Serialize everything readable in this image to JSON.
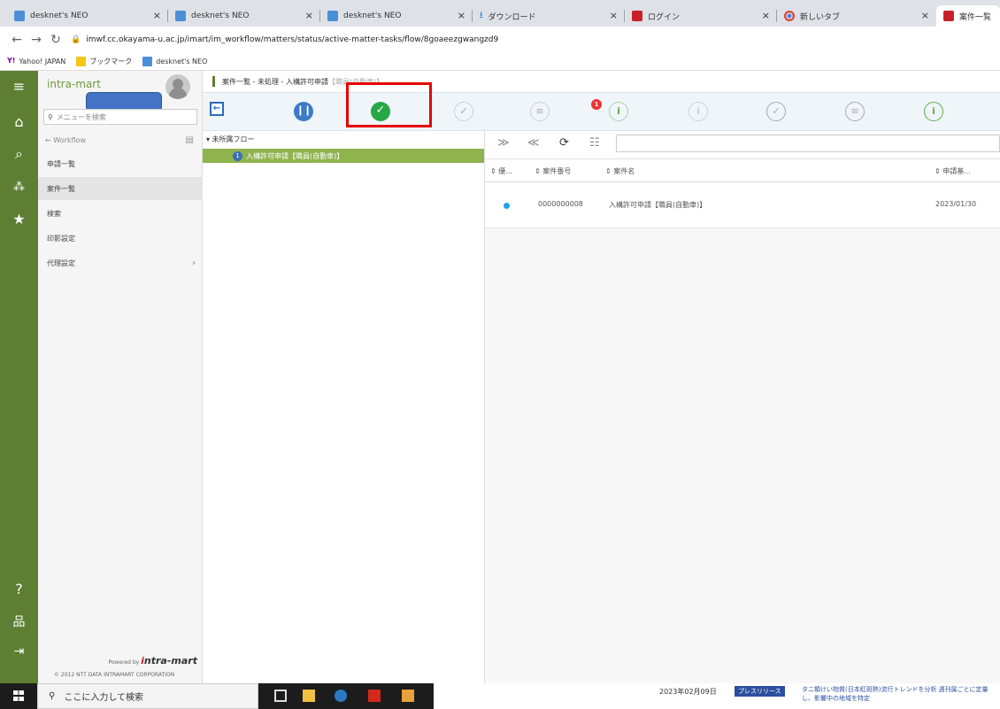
{
  "browser": {
    "tabs": [
      {
        "label": "desknet's NEO",
        "icon": "desknets-icon",
        "active": false
      },
      {
        "label": "desknet's NEO",
        "icon": "desknets-icon",
        "active": false
      },
      {
        "label": "desknet's NEO",
        "icon": "desknets-icon",
        "active": false
      },
      {
        "label": "ダウンロード",
        "icon": "download-icon",
        "active": false
      },
      {
        "label": "ログイン",
        "icon": "intramart-icon",
        "active": false
      },
      {
        "label": "新しいタブ",
        "icon": "chrome-icon",
        "active": false
      },
      {
        "label": "案件一覧",
        "icon": "intramart-icon",
        "active": true
      }
    ],
    "close_glyph": "×",
    "url": "imwf.cc.okayama-u.ac.jp/imart/im_workflow/matters/status/active-matter-tasks/flow/8goaeezgwangzd9",
    "bookmarks": [
      {
        "label": "Yahoo! JAPAN",
        "icon": "yahoo-icon"
      },
      {
        "label": "ブックマーク",
        "icon": "folder-icon"
      },
      {
        "label": "desknet's NEO",
        "icon": "desknets-icon"
      }
    ]
  },
  "sidebar": {
    "brand": "intra-mart",
    "search_placeholder": "メニューを検索",
    "back_label": "← Workflow",
    "items": [
      {
        "label": "申請一覧",
        "selected": false
      },
      {
        "label": "案件一覧",
        "selected": true
      },
      {
        "label": "検索",
        "selected": false
      },
      {
        "label": "印影設定",
        "selected": false
      },
      {
        "label": "代理設定",
        "selected": false,
        "has_children": true
      }
    ],
    "powered_by": "Powered by",
    "powered_brand_i": "i",
    "powered_brand_rest": "ntra-mart",
    "copyright": "© 2012 NTT DATA INTRAMART CORPORATION"
  },
  "breadcrumb": {
    "text": "案件一覧 - 未処理 - 入構許可申請",
    "tail": "【職員(自動車)】"
  },
  "status_toolbar": {
    "active_count": "1",
    "icons": [
      "collapse-panel-icon",
      "pause-icon",
      "approved-check-icon",
      "check-outline-icon",
      "list-outline-icon",
      "info-outline-icon",
      "info-outline-icon",
      "check-outline-icon",
      "list-outline-icon",
      "info-green-icon"
    ]
  },
  "flow_tree": {
    "root": "▾ 未所属フロー",
    "item_count": "1",
    "item_label": "入構許可申請【職員(自動車)】"
  },
  "table": {
    "columns": [
      "優...",
      "案件番号",
      "案件名",
      "申請基..."
    ],
    "sort_glyph": "⇕",
    "rows": [
      {
        "matter_no": "0000000008",
        "matter_name": "入構許可申請【職員(自動車)】",
        "date": "2023/01/30"
      }
    ]
  },
  "taskbar": {
    "search_placeholder": "ここに入力して検索",
    "news_date": "2023年02月09日",
    "news_badge": "プレスリリース",
    "news_text": "タニ類けい物質(日本紅斑熱)流行トレンドを分析 週刊属ごとに定量し、影響中の地域を特定"
  }
}
